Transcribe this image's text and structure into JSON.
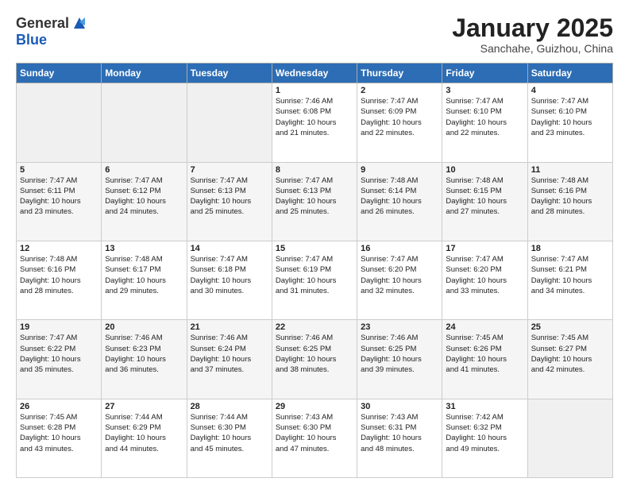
{
  "logo": {
    "general": "General",
    "blue": "Blue"
  },
  "title": {
    "month": "January 2025",
    "location": "Sanchahe, Guizhou, China"
  },
  "headers": [
    "Sunday",
    "Monday",
    "Tuesday",
    "Wednesday",
    "Thursday",
    "Friday",
    "Saturday"
  ],
  "weeks": [
    [
      {
        "day": "",
        "info": ""
      },
      {
        "day": "",
        "info": ""
      },
      {
        "day": "",
        "info": ""
      },
      {
        "day": "1",
        "info": "Sunrise: 7:46 AM\nSunset: 6:08 PM\nDaylight: 10 hours\nand 21 minutes."
      },
      {
        "day": "2",
        "info": "Sunrise: 7:47 AM\nSunset: 6:09 PM\nDaylight: 10 hours\nand 22 minutes."
      },
      {
        "day": "3",
        "info": "Sunrise: 7:47 AM\nSunset: 6:10 PM\nDaylight: 10 hours\nand 22 minutes."
      },
      {
        "day": "4",
        "info": "Sunrise: 7:47 AM\nSunset: 6:10 PM\nDaylight: 10 hours\nand 23 minutes."
      }
    ],
    [
      {
        "day": "5",
        "info": "Sunrise: 7:47 AM\nSunset: 6:11 PM\nDaylight: 10 hours\nand 23 minutes."
      },
      {
        "day": "6",
        "info": "Sunrise: 7:47 AM\nSunset: 6:12 PM\nDaylight: 10 hours\nand 24 minutes."
      },
      {
        "day": "7",
        "info": "Sunrise: 7:47 AM\nSunset: 6:13 PM\nDaylight: 10 hours\nand 25 minutes."
      },
      {
        "day": "8",
        "info": "Sunrise: 7:47 AM\nSunset: 6:13 PM\nDaylight: 10 hours\nand 25 minutes."
      },
      {
        "day": "9",
        "info": "Sunrise: 7:48 AM\nSunset: 6:14 PM\nDaylight: 10 hours\nand 26 minutes."
      },
      {
        "day": "10",
        "info": "Sunrise: 7:48 AM\nSunset: 6:15 PM\nDaylight: 10 hours\nand 27 minutes."
      },
      {
        "day": "11",
        "info": "Sunrise: 7:48 AM\nSunset: 6:16 PM\nDaylight: 10 hours\nand 28 minutes."
      }
    ],
    [
      {
        "day": "12",
        "info": "Sunrise: 7:48 AM\nSunset: 6:16 PM\nDaylight: 10 hours\nand 28 minutes."
      },
      {
        "day": "13",
        "info": "Sunrise: 7:48 AM\nSunset: 6:17 PM\nDaylight: 10 hours\nand 29 minutes."
      },
      {
        "day": "14",
        "info": "Sunrise: 7:47 AM\nSunset: 6:18 PM\nDaylight: 10 hours\nand 30 minutes."
      },
      {
        "day": "15",
        "info": "Sunrise: 7:47 AM\nSunset: 6:19 PM\nDaylight: 10 hours\nand 31 minutes."
      },
      {
        "day": "16",
        "info": "Sunrise: 7:47 AM\nSunset: 6:20 PM\nDaylight: 10 hours\nand 32 minutes."
      },
      {
        "day": "17",
        "info": "Sunrise: 7:47 AM\nSunset: 6:20 PM\nDaylight: 10 hours\nand 33 minutes."
      },
      {
        "day": "18",
        "info": "Sunrise: 7:47 AM\nSunset: 6:21 PM\nDaylight: 10 hours\nand 34 minutes."
      }
    ],
    [
      {
        "day": "19",
        "info": "Sunrise: 7:47 AM\nSunset: 6:22 PM\nDaylight: 10 hours\nand 35 minutes."
      },
      {
        "day": "20",
        "info": "Sunrise: 7:46 AM\nSunset: 6:23 PM\nDaylight: 10 hours\nand 36 minutes."
      },
      {
        "day": "21",
        "info": "Sunrise: 7:46 AM\nSunset: 6:24 PM\nDaylight: 10 hours\nand 37 minutes."
      },
      {
        "day": "22",
        "info": "Sunrise: 7:46 AM\nSunset: 6:25 PM\nDaylight: 10 hours\nand 38 minutes."
      },
      {
        "day": "23",
        "info": "Sunrise: 7:46 AM\nSunset: 6:25 PM\nDaylight: 10 hours\nand 39 minutes."
      },
      {
        "day": "24",
        "info": "Sunrise: 7:45 AM\nSunset: 6:26 PM\nDaylight: 10 hours\nand 41 minutes."
      },
      {
        "day": "25",
        "info": "Sunrise: 7:45 AM\nSunset: 6:27 PM\nDaylight: 10 hours\nand 42 minutes."
      }
    ],
    [
      {
        "day": "26",
        "info": "Sunrise: 7:45 AM\nSunset: 6:28 PM\nDaylight: 10 hours\nand 43 minutes."
      },
      {
        "day": "27",
        "info": "Sunrise: 7:44 AM\nSunset: 6:29 PM\nDaylight: 10 hours\nand 44 minutes."
      },
      {
        "day": "28",
        "info": "Sunrise: 7:44 AM\nSunset: 6:30 PM\nDaylight: 10 hours\nand 45 minutes."
      },
      {
        "day": "29",
        "info": "Sunrise: 7:43 AM\nSunset: 6:30 PM\nDaylight: 10 hours\nand 47 minutes."
      },
      {
        "day": "30",
        "info": "Sunrise: 7:43 AM\nSunset: 6:31 PM\nDaylight: 10 hours\nand 48 minutes."
      },
      {
        "day": "31",
        "info": "Sunrise: 7:42 AM\nSunset: 6:32 PM\nDaylight: 10 hours\nand 49 minutes."
      },
      {
        "day": "",
        "info": ""
      }
    ]
  ]
}
